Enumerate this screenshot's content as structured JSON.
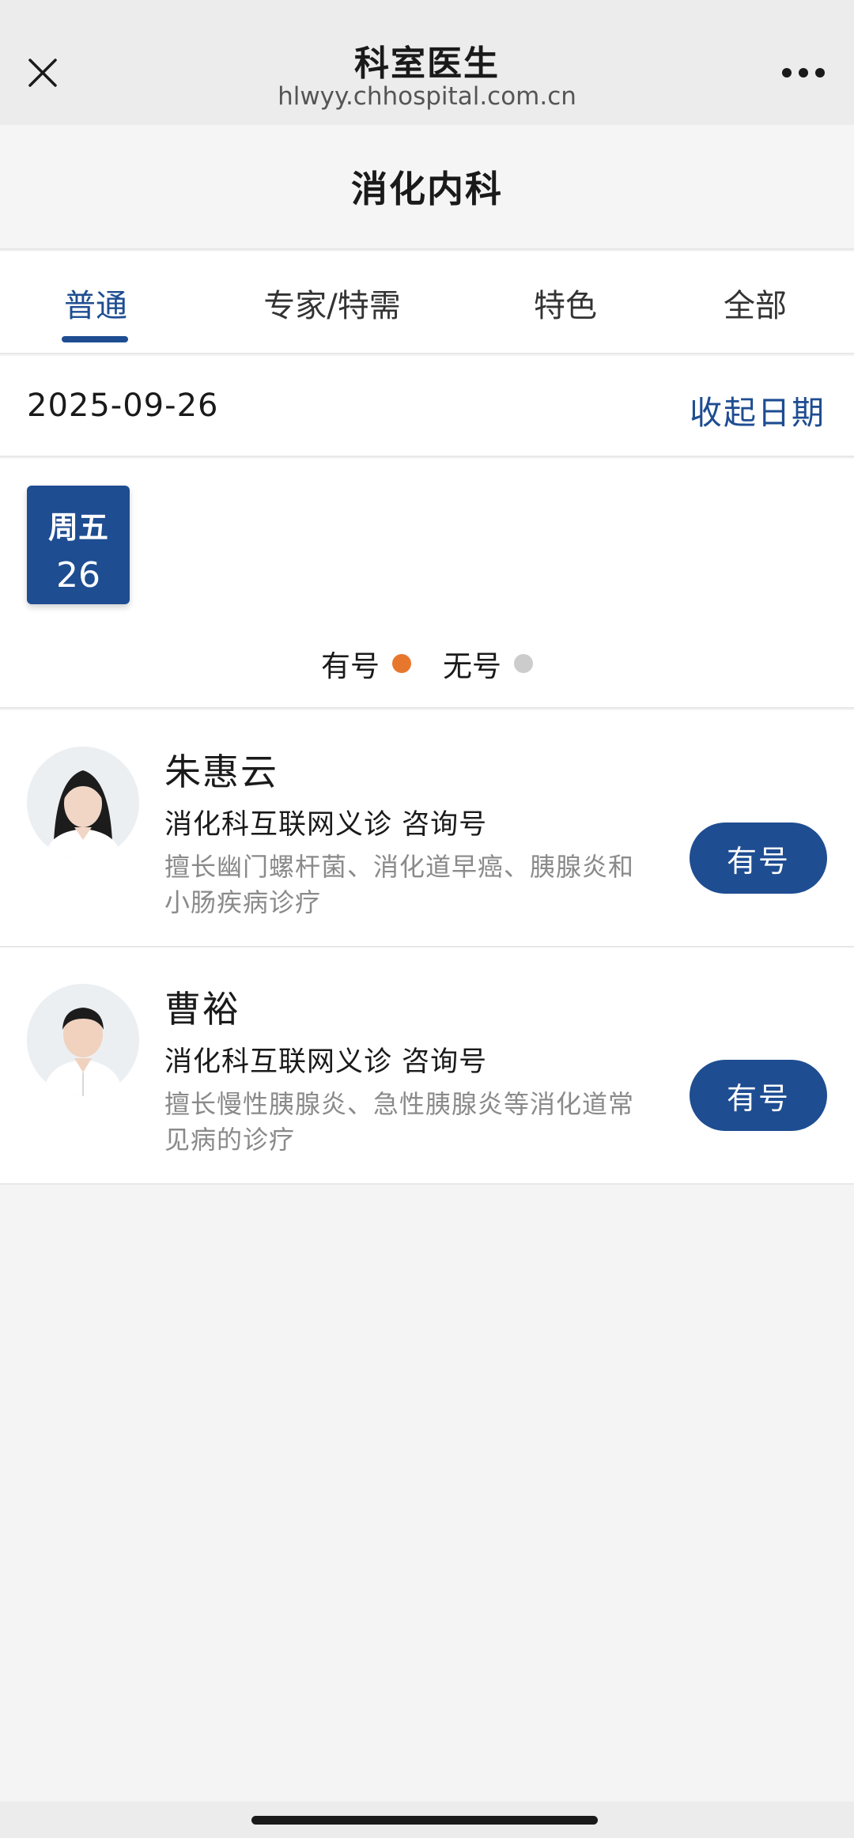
{
  "browser": {
    "title": "科室医生",
    "url": "hlwyy.chhospital.com.cn"
  },
  "page": {
    "title": "消化内科"
  },
  "tabs": [
    {
      "label": "普通",
      "active": true
    },
    {
      "label": "专家/特需",
      "active": false
    },
    {
      "label": "特色",
      "active": false
    },
    {
      "label": "全部",
      "active": false
    }
  ],
  "date_bar": {
    "date": "2025-09-26",
    "collapse_label": "收起日期"
  },
  "day_picker": {
    "selected": {
      "weekday": "周五",
      "day": "26"
    }
  },
  "legend": {
    "available_label": "有号",
    "unavailable_label": "无号",
    "available_color": "#e8772e",
    "unavailable_color": "#cccccc"
  },
  "doctors": [
    {
      "name": "朱惠云",
      "dept": "消化科互联网义诊 咨询号",
      "desc": "擅长幽门螺杆菌、消化道早癌、胰腺炎和小肠疾病诊疗",
      "status": "有号"
    },
    {
      "name": "曹裕",
      "dept": "消化科互联网义诊 咨询号",
      "desc": "擅长慢性胰腺炎、急性胰腺炎等消化道常见病的诊疗",
      "status": "有号"
    }
  ],
  "colors": {
    "accent": "#1e4d91",
    "background": "#f4f4f4"
  }
}
